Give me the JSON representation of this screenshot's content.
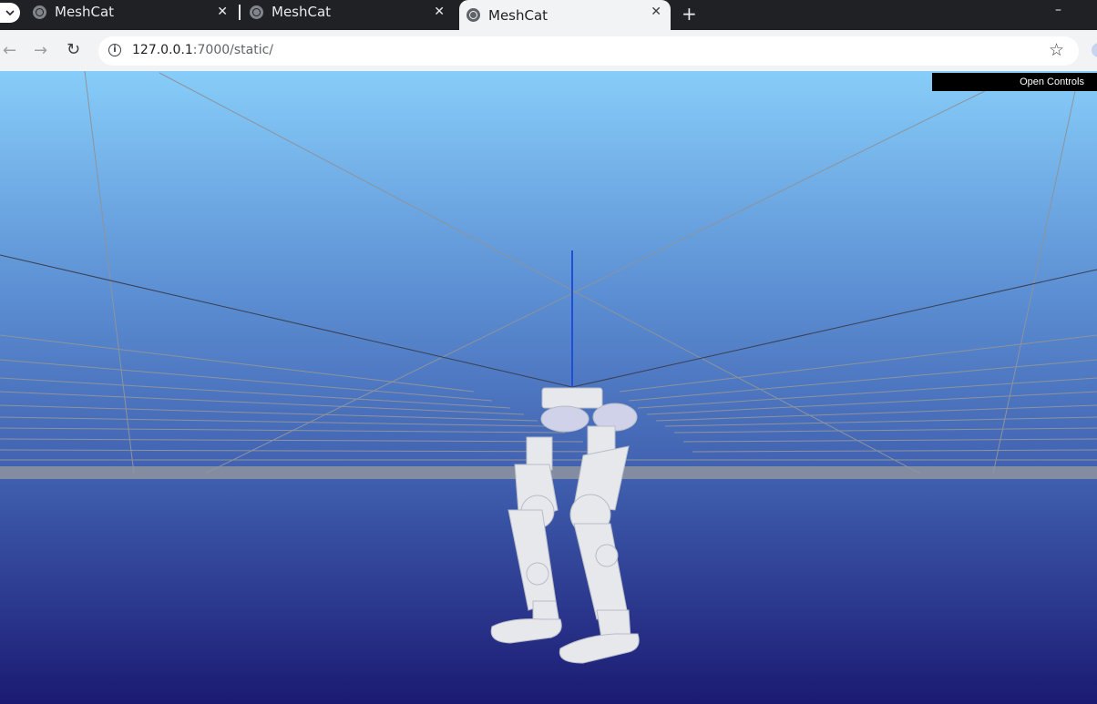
{
  "tabs": [
    {
      "title": "MeshCat",
      "close": "✕",
      "active": false
    },
    {
      "title": "MeshCat",
      "close": "✕",
      "active": false
    },
    {
      "title": "MeshCat",
      "close": "✕",
      "active": true
    }
  ],
  "newtab": "+",
  "window_minimize": "–",
  "address": {
    "host": "127.0.0.1",
    "path": ":7000/static/"
  },
  "nav": {
    "back": "←",
    "forward": "→",
    "reload": "↻",
    "bookmark": "☆",
    "info": "i"
  },
  "scene": {
    "open_controls": "Open Controls",
    "background_top": "#87cdf9",
    "background_bottom": "#1b1a73",
    "axis_color": "#1e4fd6",
    "robot_color": "#e6e8ec"
  }
}
